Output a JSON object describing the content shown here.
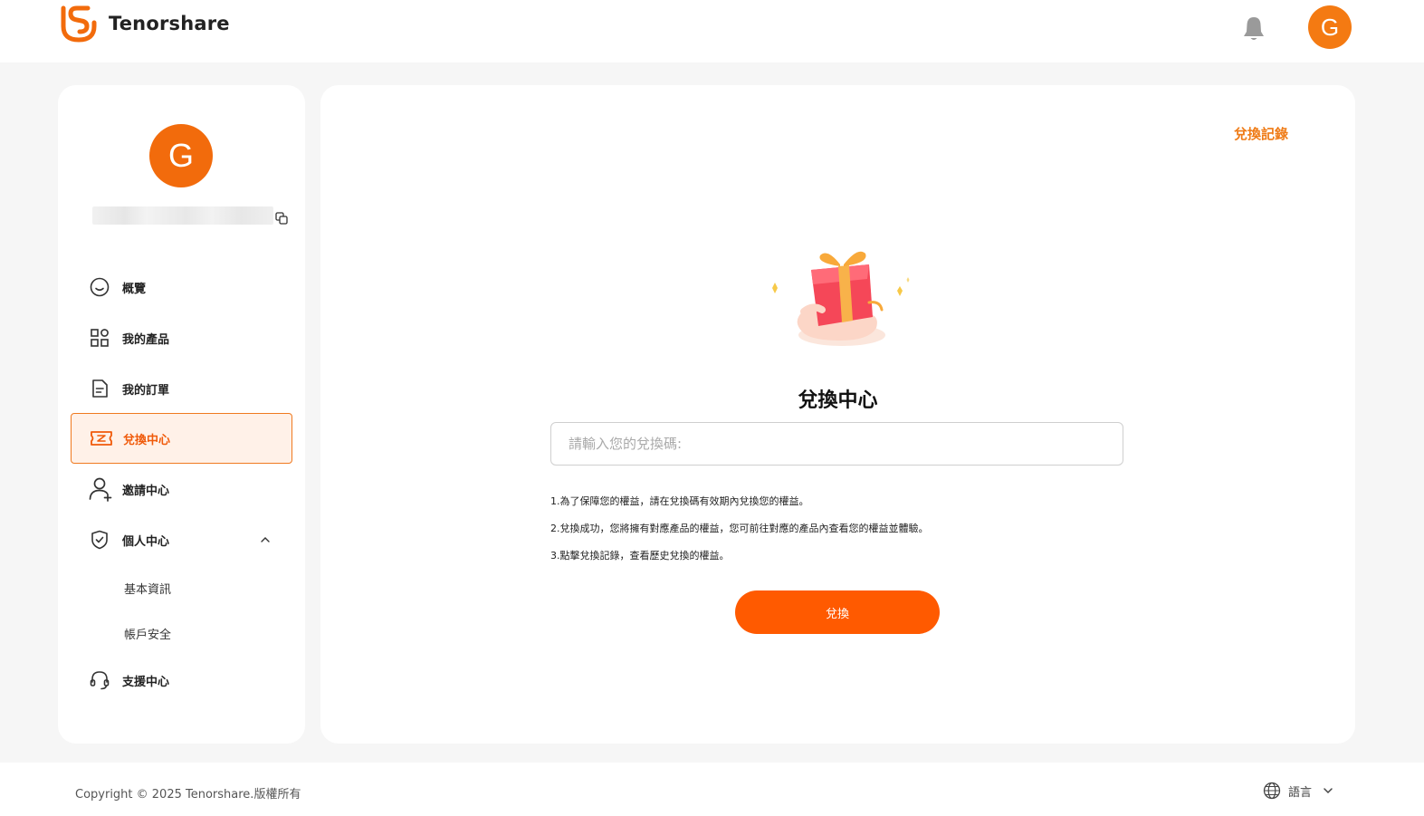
{
  "header": {
    "brand": "Tenorshare",
    "avatar_letter": "G",
    "brand_color": "#F26B0C"
  },
  "sidebar": {
    "avatar_letter": "G",
    "items": [
      {
        "label": "概覽",
        "icon": "smile-circle-icon"
      },
      {
        "label": "我的產品",
        "icon": "grid-apps-icon"
      },
      {
        "label": "我的訂單",
        "icon": "document-icon"
      },
      {
        "label": "兌換中心",
        "icon": "ticket-icon",
        "active": true
      },
      {
        "label": "邀請中心",
        "icon": "user-add-icon"
      },
      {
        "label": "個人中心",
        "icon": "shield-check-icon",
        "expanded": true
      }
    ],
    "sub_items": [
      "基本資訊",
      "帳戶安全"
    ],
    "support": {
      "label": "支援中心",
      "icon": "headset-icon"
    }
  },
  "main": {
    "history_link": "兌換記錄",
    "title": "兌換中心",
    "input_placeholder": "請輸入您的兌換碼:",
    "notes": [
      "1.為了保障您的權益，請在兌換碼有效期內兌換您的權益。",
      "2.兌換成功，您將擁有對應產品的權益，您可前往對應的產品內查看您的權益並體驗。",
      "3.點擊兌換記錄，查看歷史兌換的權益。"
    ],
    "redeem_button": "兌換"
  },
  "footer": {
    "copyright": "Copyright © 2025 Tenorshare.版權所有",
    "language_label": "語言"
  },
  "colors": {
    "accent": "#FF5A00",
    "link": "#EF7B16",
    "active_bg": "#FFF1E8"
  }
}
